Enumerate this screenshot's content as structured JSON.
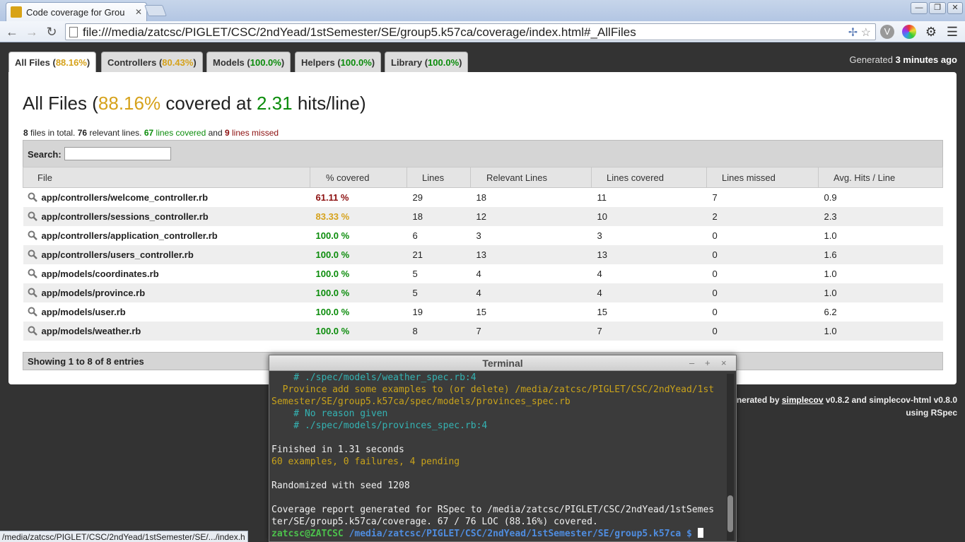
{
  "browser": {
    "tab_title": "Code coverage for Grou",
    "url": "file:///media/zatcsc/PIGLET/CSC/2ndYead/1stSemester/SE/group5.k57ca/coverage/index.html#_AllFiles",
    "status_url": "/media/zatcsc/PIGLET/CSC/2ndYead/1stSemester/SE/.../index.h"
  },
  "tabs": [
    {
      "name": "All Files",
      "pct": "88.16%",
      "color": "yellow"
    },
    {
      "name": "Controllers",
      "pct": "80.43%",
      "color": "yellow"
    },
    {
      "name": "Models",
      "pct": "100.0%",
      "color": "green"
    },
    {
      "name": "Helpers",
      "pct": "100.0%",
      "color": "green"
    },
    {
      "name": "Library",
      "pct": "100.0%",
      "color": "green"
    }
  ],
  "generated": {
    "prefix": "Generated",
    "time": "3 minutes ago"
  },
  "heading": {
    "title": "All Files",
    "pct": "88.16%",
    "mid": "covered at",
    "hits": "2.31",
    "suffix": "hits/line)"
  },
  "summary": {
    "files": "8",
    "files_text": "files in total.",
    "relevant": "76",
    "relevant_text": "relevant lines.",
    "covered": "67",
    "covered_text": "lines covered",
    "and": "and",
    "missed": "9",
    "missed_text": "lines missed"
  },
  "search": {
    "label": "Search:",
    "placeholder": ""
  },
  "table": {
    "headers": [
      "File",
      "% covered",
      "Lines",
      "Relevant Lines",
      "Lines covered",
      "Lines missed",
      "Avg. Hits / Line"
    ],
    "rows": [
      {
        "file": "app/controllers/welcome_controller.rb",
        "pct": "61.11 %",
        "color": "red",
        "lines": "29",
        "relevant": "18",
        "covered": "11",
        "missed": "7",
        "avg": "0.9"
      },
      {
        "file": "app/controllers/sessions_controller.rb",
        "pct": "83.33 %",
        "color": "yellow",
        "lines": "18",
        "relevant": "12",
        "covered": "10",
        "missed": "2",
        "avg": "2.3"
      },
      {
        "file": "app/controllers/application_controller.rb",
        "pct": "100.0 %",
        "color": "green",
        "lines": "6",
        "relevant": "3",
        "covered": "3",
        "missed": "0",
        "avg": "1.0"
      },
      {
        "file": "app/controllers/users_controller.rb",
        "pct": "100.0 %",
        "color": "green",
        "lines": "21",
        "relevant": "13",
        "covered": "13",
        "missed": "0",
        "avg": "1.6"
      },
      {
        "file": "app/models/coordinates.rb",
        "pct": "100.0 %",
        "color": "green",
        "lines": "5",
        "relevant": "4",
        "covered": "4",
        "missed": "0",
        "avg": "1.0"
      },
      {
        "file": "app/models/province.rb",
        "pct": "100.0 %",
        "color": "green",
        "lines": "5",
        "relevant": "4",
        "covered": "4",
        "missed": "0",
        "avg": "1.0"
      },
      {
        "file": "app/models/user.rb",
        "pct": "100.0 %",
        "color": "green",
        "lines": "19",
        "relevant": "15",
        "covered": "15",
        "missed": "0",
        "avg": "6.2"
      },
      {
        "file": "app/models/weather.rb",
        "pct": "100.0 %",
        "color": "green",
        "lines": "8",
        "relevant": "7",
        "covered": "7",
        "missed": "0",
        "avg": "1.0"
      }
    ]
  },
  "showing": "Showing 1 to 8 of 8 entries",
  "footer": {
    "prefix": "nerated by",
    "link": "simplecov",
    "rest": "v0.8.2 and simplecov-html v0.8.0",
    "line2": "using RSpec"
  },
  "terminal": {
    "title": "Terminal",
    "lines": [
      {
        "cls": "t-cyan",
        "text": "    # ./spec/models/weather_spec.rb:4"
      },
      {
        "cls": "t-yellow",
        "text": "  Province add some examples to (or delete) /media/zatcsc/PIGLET/CSC/2ndYead/1st"
      },
      {
        "cls": "t-yellow",
        "text": "Semester/SE/group5.k57ca/spec/models/provinces_spec.rb"
      },
      {
        "cls": "t-cyan",
        "text": "    # No reason given"
      },
      {
        "cls": "t-cyan",
        "text": "    # ./spec/models/provinces_spec.rb:4"
      },
      {
        "cls": "",
        "text": ""
      },
      {
        "cls": "",
        "text": "Finished in 1.31 seconds"
      },
      {
        "cls": "t-yellow",
        "text": "60 examples, 0 failures, 4 pending"
      },
      {
        "cls": "",
        "text": ""
      },
      {
        "cls": "",
        "text": "Randomized with seed 1208"
      },
      {
        "cls": "",
        "text": ""
      },
      {
        "cls": "",
        "text": "Coverage report generated for RSpec to /media/zatcsc/PIGLET/CSC/2ndYead/1stSemes"
      },
      {
        "cls": "",
        "text": "ter/SE/group5.k57ca/coverage. 67 / 76 LOC (88.16%) covered."
      }
    ],
    "prompt_user": "zatcsc@ZATCSC",
    "prompt_path": " /media/zatcsc/PIGLET/CSC/2ndYead/1stSemester/SE/group5.k57ca $ "
  },
  "colors": {
    "yellow": "#d6a21b",
    "green": "#0b8c0b",
    "red": "#8c0f0f"
  }
}
